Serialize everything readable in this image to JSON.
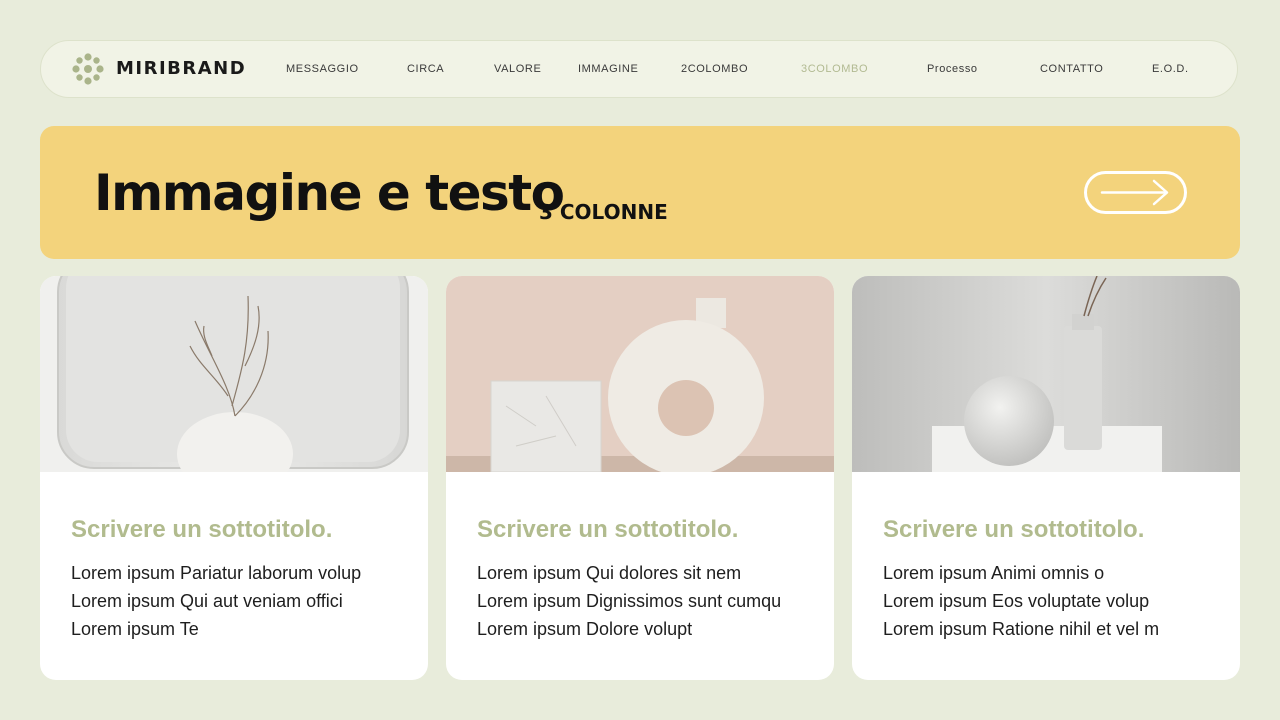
{
  "nav": {
    "brand": "MIRIBRAND",
    "logo_icon": "flower-dots-icon",
    "items": [
      {
        "label": "MESSAGGIO"
      },
      {
        "label": "CIRCA"
      },
      {
        "label": "VALORE"
      },
      {
        "label": "IMMAGINE"
      },
      {
        "label": "2COLOMBO"
      },
      {
        "label": "3COLOMBO",
        "active": true
      },
      {
        "label": "Processo"
      },
      {
        "label": "CONTATTO"
      },
      {
        "label": "E.O.D."
      }
    ]
  },
  "hero": {
    "title": "Immagine e testo",
    "subtitle": "3 COLONNE",
    "arrow_icon": "arrow-right-icon"
  },
  "cards": [
    {
      "image": "vase-with-branches-photo",
      "title": "Scrivere un sottotitolo.",
      "lines": [
        "Lorem ipsum Pariatur laborum volup",
        "Lorem ipsum Qui aut veniam offici",
        "Lorem ipsum Te"
      ]
    },
    {
      "image": "ring-vase-and-cube-photo",
      "title": "Scrivere un sottotitolo.",
      "lines": [
        "Lorem ipsum Qui dolores sit nem",
        "Lorem ipsum Dignissimos sunt cumqu",
        "Lorem ipsum Dolore volupt"
      ]
    },
    {
      "image": "sphere-and-bottle-photo",
      "title": "Scrivere un sottotitolo.",
      "lines": [
        "Lorem ipsum Animi omnis o",
        "Lorem ipsum Eos voluptate volup",
        "Lorem ipsum Ratione nihil et vel m"
      ]
    }
  ],
  "colors": {
    "background": "#e8ecdb",
    "nav_background": "#f1f3e6",
    "hero_background": "#f3d37c",
    "accent_green": "#b1bb8e",
    "active_nav": "#b2ba92"
  }
}
